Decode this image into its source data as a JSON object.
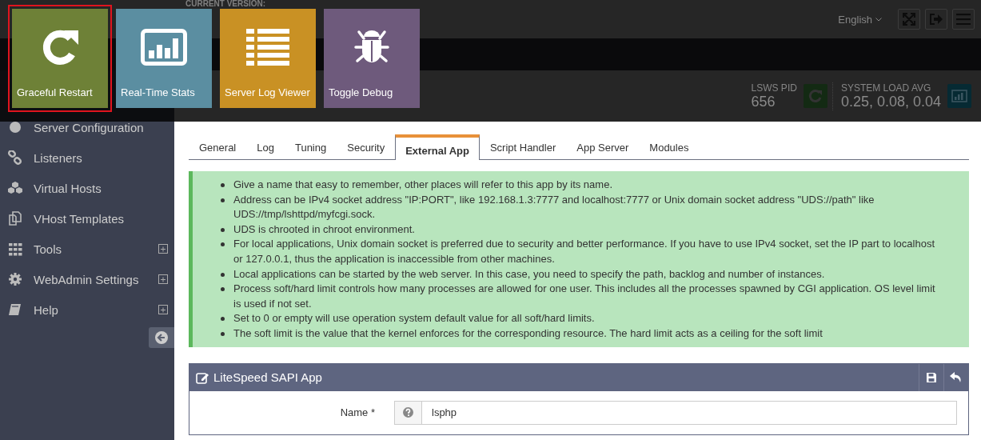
{
  "header": {
    "version_label": "CURRENT VERSION:",
    "language": "English"
  },
  "stats": [
    {
      "label": "LSWS PID",
      "value": "656"
    },
    {
      "label": "SYSTEM LOAD AVG",
      "value": "0.25, 0.08, 0.04"
    }
  ],
  "sidebar": {
    "items": [
      {
        "label": "Server Configuration",
        "expandable": false
      },
      {
        "label": "Listeners",
        "expandable": false
      },
      {
        "label": "Virtual Hosts",
        "expandable": false
      },
      {
        "label": "VHost Templates",
        "expandable": false
      },
      {
        "label": "Tools",
        "expandable": true
      },
      {
        "label": "WebAdmin Settings",
        "expandable": true
      },
      {
        "label": "Help",
        "expandable": true
      }
    ]
  },
  "tabs": [
    {
      "label": "General",
      "selected": false
    },
    {
      "label": "Log",
      "selected": false
    },
    {
      "label": "Tuning",
      "selected": false
    },
    {
      "label": "Security",
      "selected": false
    },
    {
      "label": "External App",
      "selected": true
    },
    {
      "label": "Script Handler",
      "selected": false
    },
    {
      "label": "App Server",
      "selected": false
    },
    {
      "label": "Modules",
      "selected": false
    }
  ],
  "notes": [
    "Give a name that easy to remember, other places will refer to this app by its name.",
    "Address can be IPv4 socket address \"IP:PORT\", like 192.168.1.3:7777 and localhost:7777 or Unix domain socket address \"UDS://path\" like UDS://tmp/lshttpd/myfcgi.sock.",
    "UDS is chrooted in chroot environment.",
    "For local applications, Unix domain socket is preferred due to security and better performance. If you have to use IPv4 socket, set the IP part to localhost or 127.0.0.1, thus the application is inaccessible from other machines.",
    "Local applications can be started by the web server. In this case, you need to specify the path, backlog and number of instances.",
    "Process soft/hard limit controls how many processes are allowed for one user. This includes all the processes spawned by CGI application. OS level limit is used if not set.",
    "Set to 0 or empty will use operation system default value for all soft/hard limits.",
    "The soft limit is the value that the kernel enforces for the corresponding resource. The hard limit acts as a ceiling for the soft limit"
  ],
  "panel": {
    "title": "LiteSpeed SAPI App",
    "fields": [
      {
        "label": "Name *",
        "value": "lsphp"
      }
    ]
  },
  "quick_actions": [
    {
      "label": "Graceful Restart",
      "color": "#6e8137",
      "selected": true
    },
    {
      "label": "Real-Time Stats",
      "color": "#5b8ea1",
      "selected": false
    },
    {
      "label": "Server Log Viewer",
      "color": "#c99124",
      "selected": false
    },
    {
      "label": "Toggle Debug",
      "color": "#6e5a7c",
      "selected": false
    }
  ]
}
